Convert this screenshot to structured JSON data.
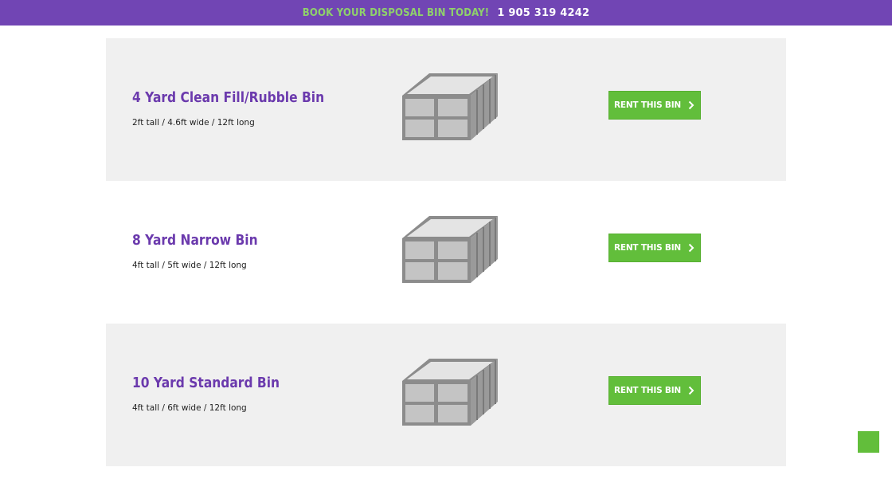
{
  "topbar": {
    "promo_text": "BOOK YOUR DISPOSAL BIN TODAY!",
    "phone": "1 905 319 4242"
  },
  "bins": [
    {
      "title": "4 Yard Clean Fill/Rubble Bin",
      "dimensions": "2ft tall / 4.6ft wide / 12ft long",
      "button_label": "RENT THIS BIN"
    },
    {
      "title": "8 Yard Narrow Bin",
      "dimensions": "4ft tall / 5ft wide / 12ft long",
      "button_label": "RENT THIS BIN"
    },
    {
      "title": "10 Yard Standard Bin",
      "dimensions": "4ft tall / 6ft wide / 12ft long",
      "button_label": "RENT THIS BIN"
    }
  ],
  "icons": {
    "button_chevron": "chevron-right-icon",
    "bin_picture": "dumpster-bin-icon"
  },
  "colors": {
    "brand_purple": "#7145b4",
    "title_purple": "#6b3aad",
    "accent_green": "#62be3b",
    "promo_green": "#8fd16b",
    "row_shade": "#f0f0f0"
  }
}
